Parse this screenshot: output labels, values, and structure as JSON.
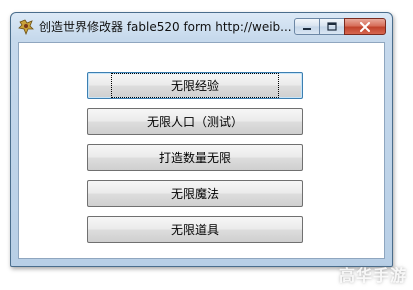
{
  "window": {
    "title": "创造世界修改器 fable520 form http://weib..."
  },
  "caption": {
    "minimize_icon": "minimize-icon",
    "maximize_icon": "maximize-icon",
    "close_icon": "close-icon"
  },
  "buttons": [
    {
      "label": "无限经验"
    },
    {
      "label": "无限人口（测试）"
    },
    {
      "label": "打造数量无限"
    },
    {
      "label": "无限魔法"
    },
    {
      "label": "无限道具"
    }
  ],
  "watermark": "高华手游"
}
